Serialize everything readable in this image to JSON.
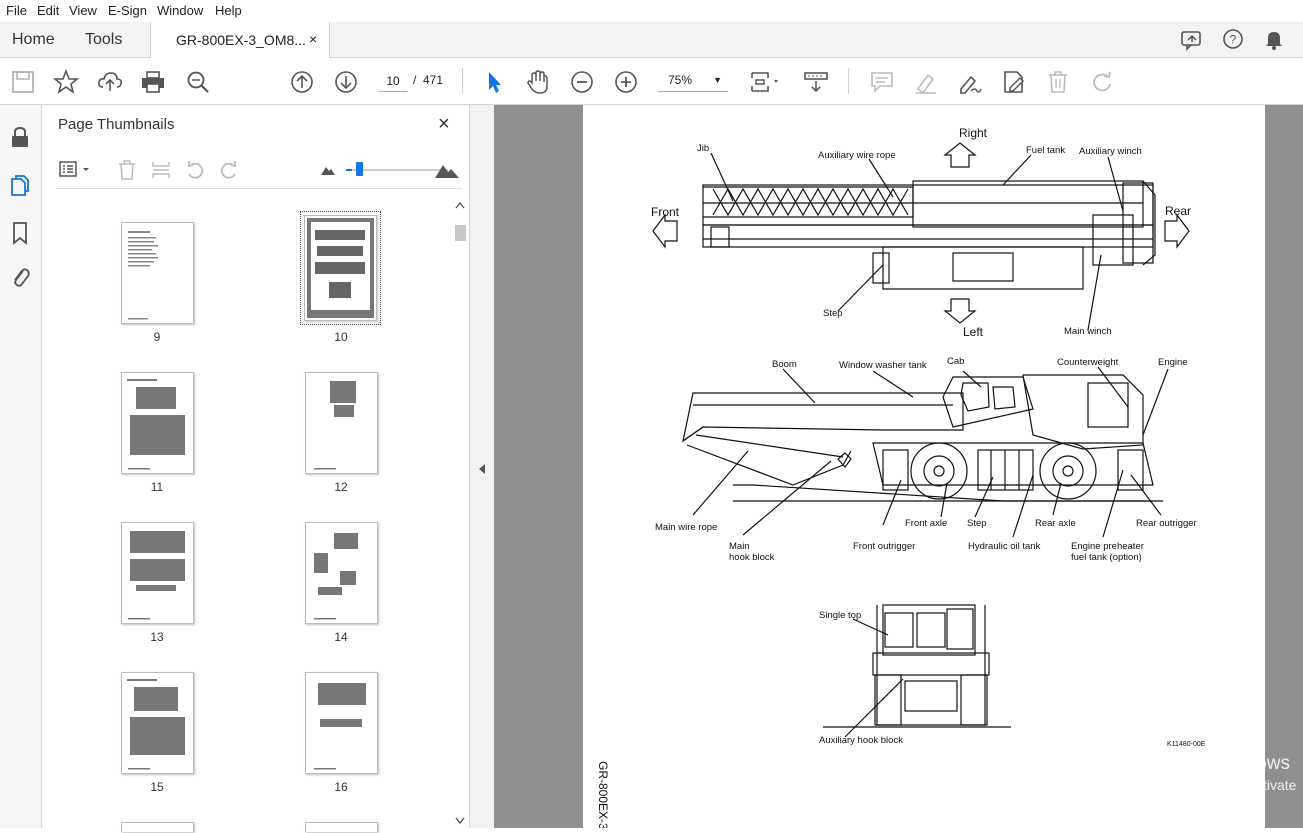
{
  "menu": {
    "file": "File",
    "edit": "Edit",
    "view": "View",
    "esign": "E-Sign",
    "window": "Window",
    "help": "Help"
  },
  "tabs": {
    "home": "Home",
    "tools": "Tools",
    "doc": "GR-800EX-3_OM8...",
    "close": "×"
  },
  "toolbar": {
    "current_page": "10",
    "page_sep": "/",
    "total_pages": "471",
    "zoom": "75%"
  },
  "panel": {
    "title": "Page Thumbnails",
    "close": "×",
    "thumbnails": [
      "9",
      "10",
      "11",
      "12",
      "13",
      "14",
      "15",
      "16"
    ],
    "selected": "10"
  },
  "figure": {
    "labels": {
      "jib": "Jib",
      "aux_wire_rope": "Auxiliary wire rope",
      "right": "Right",
      "fuel_tank": "Fuel tank",
      "aux_winch": "Auxiliary winch",
      "front": "Front",
      "rear": "Rear",
      "step_top": "Step",
      "left": "Left",
      "main_winch": "Main winch",
      "boom": "Boom",
      "window_washer": "Window washer tank",
      "cab": "Cab",
      "counterweight": "Counterweight",
      "engine": "Engine",
      "main_wire_rope": "Main wire rope",
      "front_axle": "Front axle",
      "step_mid": "Step",
      "rear_axle": "Rear axle",
      "rear_outrigger": "Rear outrigger",
      "main_hook_1": "Main",
      "main_hook_2": "hook block",
      "front_outrigger": "Front outrigger",
      "hydraulic": "Hydraulic oil tank",
      "eng_pre_1": "Engine preheater",
      "eng_pre_2": "fuel tank (option)",
      "single_top": "Single top",
      "aux_hook": "Auxiliary hook block",
      "fig_code": "K11480-00E",
      "side_text": "GR-800EX-3"
    }
  },
  "watermark": {
    "line1": "Activate Windows",
    "line2": "Go to Settings to activate"
  },
  "icons": [
    "save-icon",
    "star-icon",
    "upload-icon",
    "print-icon",
    "find-icon",
    "prev-page-icon",
    "next-page-icon",
    "select-icon",
    "hand-icon",
    "zoom-out-icon",
    "zoom-in-icon",
    "fit-icon",
    "scroll-icon",
    "comment-icon",
    "highlight-icon",
    "sign-icon",
    "edit-icon",
    "delete-icon",
    "redo-icon",
    "share-icon",
    "help-icon",
    "bell-icon",
    "lock-icon",
    "pages-icon",
    "bookmark-icon",
    "attachment-icon"
  ],
  "colors": {
    "accent": "#1473e6",
    "viewer_bg": "#8f8f8f"
  }
}
